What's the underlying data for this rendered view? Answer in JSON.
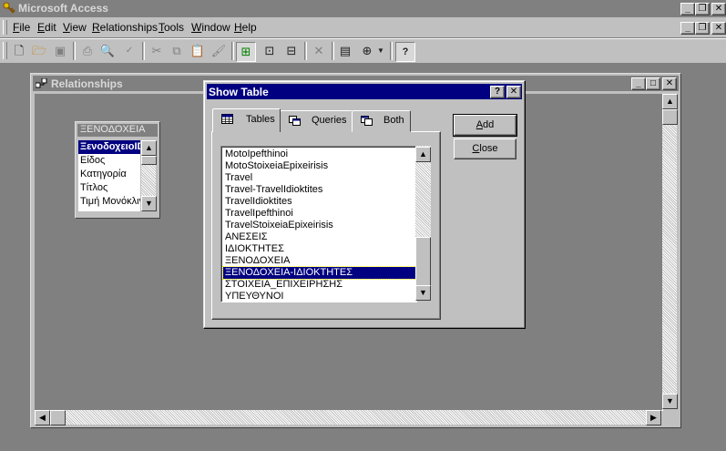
{
  "app": {
    "title": "Microsoft Access",
    "controls": [
      "_",
      "❐",
      "✕"
    ]
  },
  "menu": {
    "items": [
      "File",
      "Edit",
      "View",
      "Relationships",
      "Tools",
      "Window",
      "Help"
    ]
  },
  "toolbar": {
    "buttons": [
      "new-icon",
      "open-icon",
      "save-icon",
      "print-icon",
      "print-preview-icon",
      "spelling-icon",
      "cut-icon",
      "copy-icon",
      "paste-icon",
      "format-painter-icon",
      "show-table-icon",
      "show-direct-icon",
      "show-all-icon",
      "delete-icon",
      "properties-icon",
      "new-object-icon",
      "help-icon"
    ]
  },
  "relationships": {
    "title": "Relationships",
    "controls": [
      "_",
      "□",
      "✕"
    ],
    "field_list": {
      "title": "ΞΕΝΟΔΟΧΕΙΑ",
      "fields": [
        "ΞενοδοχειοID",
        "Είδος",
        "Κατηγορία",
        "Τίτλος",
        "Τιμή Μονόκλινου"
      ],
      "selected_index": 0
    }
  },
  "dialog": {
    "title": "Show Table",
    "controls": [
      "?",
      "✕"
    ],
    "tabs": [
      "Tables",
      "Queries",
      "Both"
    ],
    "active_tab": "Tables",
    "list": [
      "MotoIpefthinoi",
      "MotoStoixeiaEpixeirisis",
      "Travel",
      "Travel-TravelIdioktites",
      "TravelIdioktites",
      "TravelIpefthinoi",
      "TravelStoixeiaEpixeirisis",
      "ΑΝΕΣΕΙΣ",
      "ΙΔΙΟΚΤΗΤΕΣ",
      "ΞΕΝΟΔΟΧΕΙΑ",
      "ΞΕΝΟΔΟΧΕΙΑ-ΙΔΙΟΚΤΗΤΕΣ",
      "ΣΤΟΙΧΕΙΑ_ΕΠΙΧΕΙΡΗΣΗΣ",
      "ΥΠΕΥΘΥΝΟΙ"
    ],
    "selected_item": "ΞΕΝΟΔΟΧΕΙΑ-ΙΔΙΟΚΤΗΤΕΣ",
    "buttons": {
      "add": "Add",
      "close": "Close"
    }
  }
}
